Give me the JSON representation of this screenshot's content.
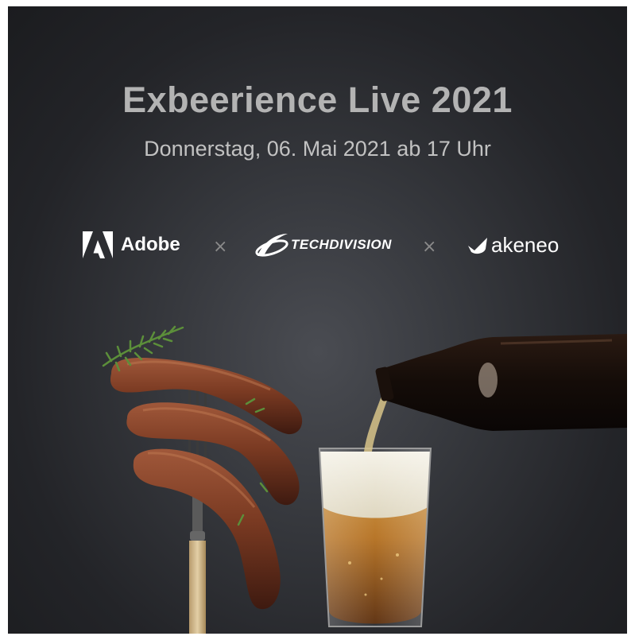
{
  "poster": {
    "title": "Exbeerience Live 2021",
    "subtitle": "Donnerstag, 06. Mai 2021 ab 17 Uhr"
  },
  "partners": {
    "adobe": "Adobe",
    "separator": "×",
    "techdivision": "TECHDIVISION",
    "akeneo": "akeneo"
  },
  "colors": {
    "background": "#2c2d31",
    "title": "#b3b3b3",
    "subtitle": "#c2c2c2",
    "logo": "#ffffff",
    "separator": "#8a8a8a"
  },
  "icons": [
    "adobe-logo-icon",
    "techdivision-swoosh-icon",
    "akeneo-logo-icon"
  ],
  "image": "sausages-on-fork-and-beer-pouring"
}
